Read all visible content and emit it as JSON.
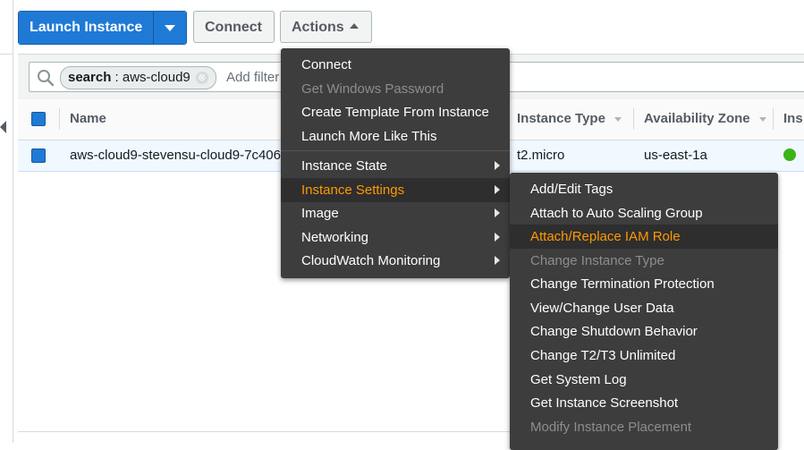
{
  "toolbar": {
    "launch_label": "Launch Instance",
    "connect_label": "Connect",
    "actions_label": "Actions"
  },
  "search": {
    "token_key": "search",
    "token_value": " : aws-cloud9",
    "token_close": "⊗",
    "placeholder": "Add filter"
  },
  "table": {
    "columns": [
      "Name",
      "Instance Type",
      "Availability Zone",
      "Ins"
    ],
    "row": {
      "name": "aws-cloud9-stevensu-cloud9-7c406",
      "instance_type": "t2.micro",
      "availability_zone": "us-east-1a",
      "status_color": "#3bb417"
    }
  },
  "actions_menu": {
    "items": [
      {
        "label": "Connect",
        "state": "enabled"
      },
      {
        "label": "Get Windows Password",
        "state": "disabled"
      },
      {
        "label": "Create Template From Instance",
        "state": "enabled"
      },
      {
        "label": "Launch More Like This",
        "state": "enabled"
      },
      {
        "label": "Instance State",
        "state": "enabled",
        "submenu": true
      },
      {
        "label": "Instance Settings",
        "state": "highlighted",
        "submenu": true
      },
      {
        "label": "Image",
        "state": "enabled",
        "submenu": true
      },
      {
        "label": "Networking",
        "state": "enabled",
        "submenu": true
      },
      {
        "label": "CloudWatch Monitoring",
        "state": "enabled",
        "submenu": true
      }
    ]
  },
  "instance_settings_menu": {
    "items": [
      {
        "label": "Add/Edit Tags",
        "state": "enabled"
      },
      {
        "label": "Attach to Auto Scaling Group",
        "state": "enabled"
      },
      {
        "label": "Attach/Replace IAM Role",
        "state": "highlighted"
      },
      {
        "label": "Change Instance Type",
        "state": "disabled"
      },
      {
        "label": "Change Termination Protection",
        "state": "enabled"
      },
      {
        "label": "View/Change User Data",
        "state": "enabled"
      },
      {
        "label": "Change Shutdown Behavior",
        "state": "enabled"
      },
      {
        "label": "Change T2/T3 Unlimited",
        "state": "enabled"
      },
      {
        "label": "Get System Log",
        "state": "enabled"
      },
      {
        "label": "Get Instance Screenshot",
        "state": "enabled"
      },
      {
        "label": "Modify Instance Placement",
        "state": "disabled"
      }
    ]
  },
  "colors": {
    "primary": "#1f7ad6",
    "menu_bg": "#3d3d3d",
    "menu_highlight": "#ff9900"
  }
}
